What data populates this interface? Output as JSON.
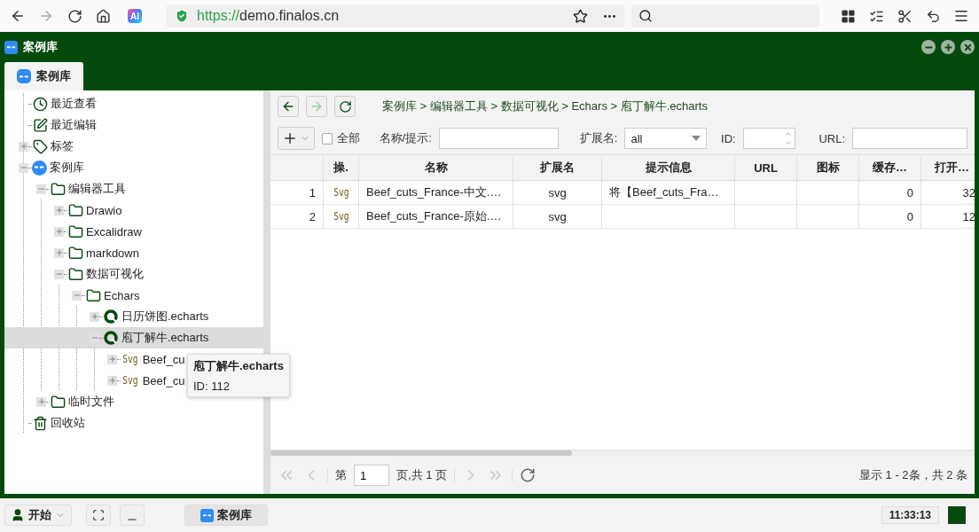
{
  "browser": {
    "url_scheme": "https://",
    "url_host": "demo.finalos.cn",
    "ai_label": "AI"
  },
  "window": {
    "title": "案例库"
  },
  "tabs": [
    {
      "label": "案例库",
      "selected": true
    }
  ],
  "tree": {
    "items": [
      {
        "label": "最近查看",
        "kind": "clock",
        "selected": false
      },
      {
        "label": "最近编辑",
        "kind": "edit",
        "selected": false
      },
      {
        "label": "标签",
        "kind": "tag",
        "expanded": false,
        "selected": false
      },
      {
        "label": "案例库",
        "kind": "app",
        "expanded": true,
        "selected": false,
        "children": [
          {
            "label": "编辑器工具",
            "kind": "folder",
            "expanded": true,
            "selected": false,
            "children": [
              {
                "label": "Drawio",
                "kind": "folder",
                "expanded": false,
                "selected": false
              },
              {
                "label": "Excalidraw",
                "kind": "folder",
                "expanded": false,
                "selected": false
              },
              {
                "label": "markdown",
                "kind": "folder",
                "expanded": false,
                "selected": false
              },
              {
                "label": "数据可视化",
                "kind": "folder",
                "expanded": true,
                "selected": false,
                "children": [
                  {
                    "label": "Echars",
                    "kind": "folder",
                    "expanded": true,
                    "selected": false,
                    "children": [
                      {
                        "label": "日历饼图.echarts",
                        "kind": "chart",
                        "expanded": false,
                        "selected": false
                      },
                      {
                        "label": "庖丁解牛.echarts",
                        "kind": "chart",
                        "expanded": true,
                        "selected": true,
                        "children": [
                          {
                            "label": "Beef_cu",
                            "kind": "svg",
                            "badge": "Svg",
                            "expanded": false,
                            "selected": false
                          },
                          {
                            "label": "Beef_cu",
                            "kind": "svg",
                            "badge": "Svg",
                            "expanded": false,
                            "selected": false
                          }
                        ]
                      }
                    ]
                  }
                ]
              }
            ]
          },
          {
            "label": "临时文件",
            "kind": "folder",
            "expanded": false,
            "selected": false
          }
        ]
      },
      {
        "label": "回收站",
        "kind": "trash",
        "selected": false
      }
    ]
  },
  "tooltip": {
    "title": "庖丁解牛.echarts",
    "text": "ID: 112"
  },
  "nav": {
    "back_disabled": false,
    "forward_disabled": true,
    "breadcrumb": "案例库 > 编辑器工具 > 数据可视化 > Echars > 庖丁解牛.echarts"
  },
  "filters": {
    "all_label": "全部",
    "all_checked": false,
    "name_label": "名称/提示:",
    "ext_label": "扩展名:",
    "ext_value": "all",
    "id_label": "ID:",
    "url_label": "URL:"
  },
  "table": {
    "columns": [
      "操.",
      "名称",
      "扩展名",
      "提示信息",
      "URL",
      "图标",
      "缓存…",
      "打开…"
    ],
    "rows": [
      {
        "number": "1",
        "badge": "Svg",
        "name": "Beef_cuts_France-中文.…",
        "ext": "svg",
        "hint": "将【Beef_cuts_Fra…",
        "cache": "0",
        "open": "32"
      },
      {
        "number": "2",
        "badge": "Svg",
        "name": "Beef_cuts_France-原始.…",
        "ext": "svg",
        "cache": "0",
        "open": "12"
      }
    ]
  },
  "pager": {
    "page_prefix": "第",
    "page": "1",
    "page_suffix": "页,共 1 页",
    "summary": "显示 1 - 2条，共 2 条"
  },
  "taskbar": {
    "start": "开始",
    "app": "案例库",
    "clock": "11:33:13"
  }
}
